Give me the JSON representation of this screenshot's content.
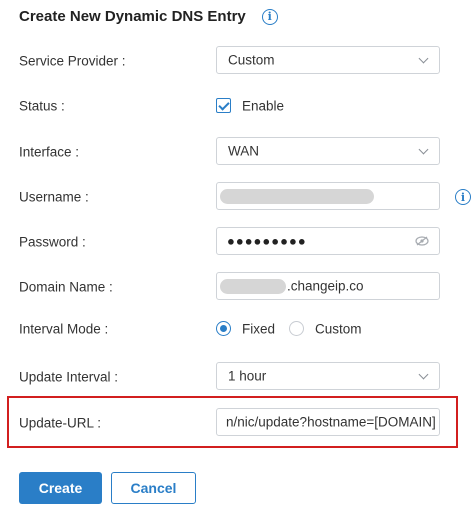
{
  "form": {
    "title": "Create New Dynamic DNS Entry",
    "fields": {
      "service_provider": {
        "label": "Service Provider",
        "value": "Custom"
      },
      "status": {
        "label": "Status",
        "checkbox_label": "Enable",
        "checked": true
      },
      "interface": {
        "label": "Interface",
        "value": "WAN"
      },
      "username": {
        "label": "Username",
        "value": ""
      },
      "password": {
        "label": "Password",
        "value": "●●●●●●●●●"
      },
      "domain_name": {
        "label": "Domain Name",
        "value": ".changeip.co"
      },
      "interval_mode": {
        "label": "Interval Mode",
        "options": [
          "Fixed",
          "Custom"
        ],
        "selected": "Fixed"
      },
      "update_interval": {
        "label": "Update Interval",
        "value": "1 hour"
      },
      "update_url": {
        "label": "Update-URL",
        "value": "n/nic/update?hostname=[DOMAIN]"
      }
    },
    "buttons": {
      "create": "Create",
      "cancel": "Cancel"
    }
  },
  "colors": {
    "accent": "#2a7ec7",
    "highlight": "#d21f1f"
  },
  "icons": {
    "info": "info-icon",
    "chevron": "chevron-down-icon",
    "eye": "eye-slash-icon"
  }
}
